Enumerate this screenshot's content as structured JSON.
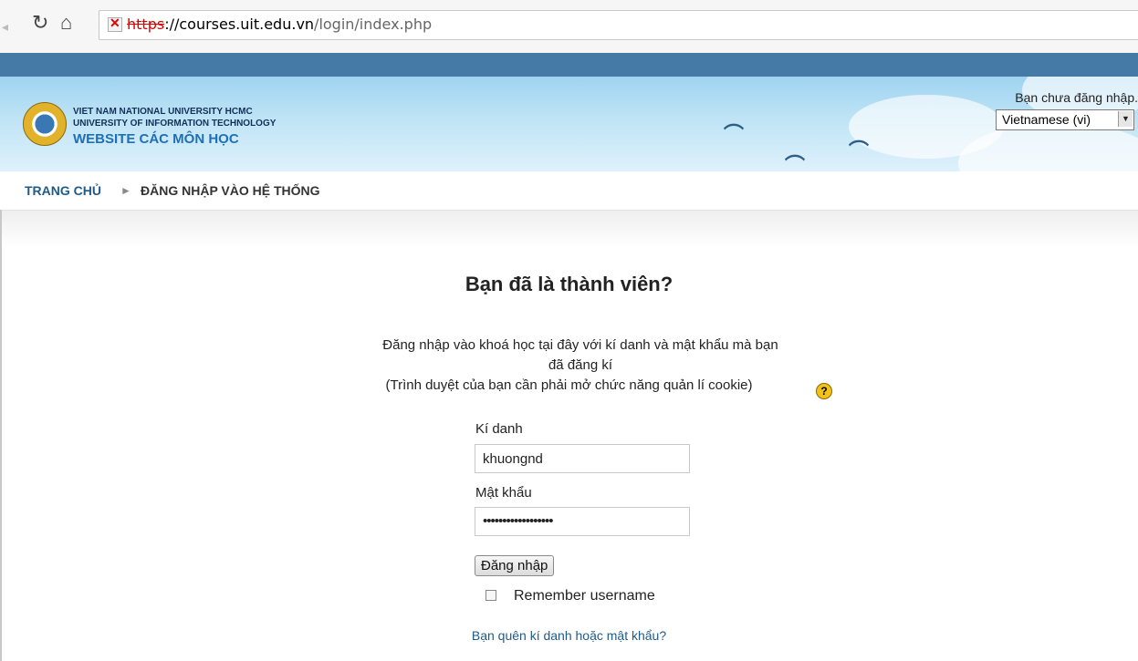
{
  "browser": {
    "url_scheme": "https",
    "url_host": "://courses.uit.edu.vn",
    "url_path": "/login/index.php"
  },
  "header": {
    "logo_line1": "VIET NAM NATIONAL UNIVERSITY HCMC",
    "logo_line2": "UNIVERSITY OF INFORMATION TECHNOLOGY",
    "logo_line3": "WEBSITE CÁC MÔN HỌC",
    "login_status": "Bạn chưa đăng nhập.",
    "language": "Vietnamese (vi)"
  },
  "breadcrumb": {
    "home": "TRANG CHỦ",
    "separator": "►",
    "current": "ĐĂNG NHẬP VÀO HỆ THỐNG"
  },
  "login": {
    "title": "Bạn đã là thành viên?",
    "desc_line1": "Đăng nhập vào khoá học tại đây với kí danh và mật khẩu mà bạn",
    "desc_line2": "đã đăng kí",
    "desc_line3": "(Trình duyệt của bạn cần phải mở chức năng quản lí cookie)",
    "username_label": "Kí danh",
    "username_value": "khuongnd",
    "password_label": "Mật khẩu",
    "password_value": "••••••••••••••••••",
    "submit_label": "Đăng nhập",
    "remember_label": "Remember username",
    "remember_checked": false,
    "forgot_link": "Bạn quên kí danh hoặc mật khẩu?"
  },
  "icons": {
    "back": "back-arrow-icon",
    "reload": "reload-icon",
    "home": "home-icon",
    "insecure": "insecure-lock-icon",
    "help": "help-icon",
    "logo": "university-logo-icon",
    "birds": "bird-icon"
  },
  "colors": {
    "topbar": "#457aa6",
    "link": "#1f5a8a",
    "header_sky": "#bfe4f6",
    "insecure": "#dd0000"
  }
}
